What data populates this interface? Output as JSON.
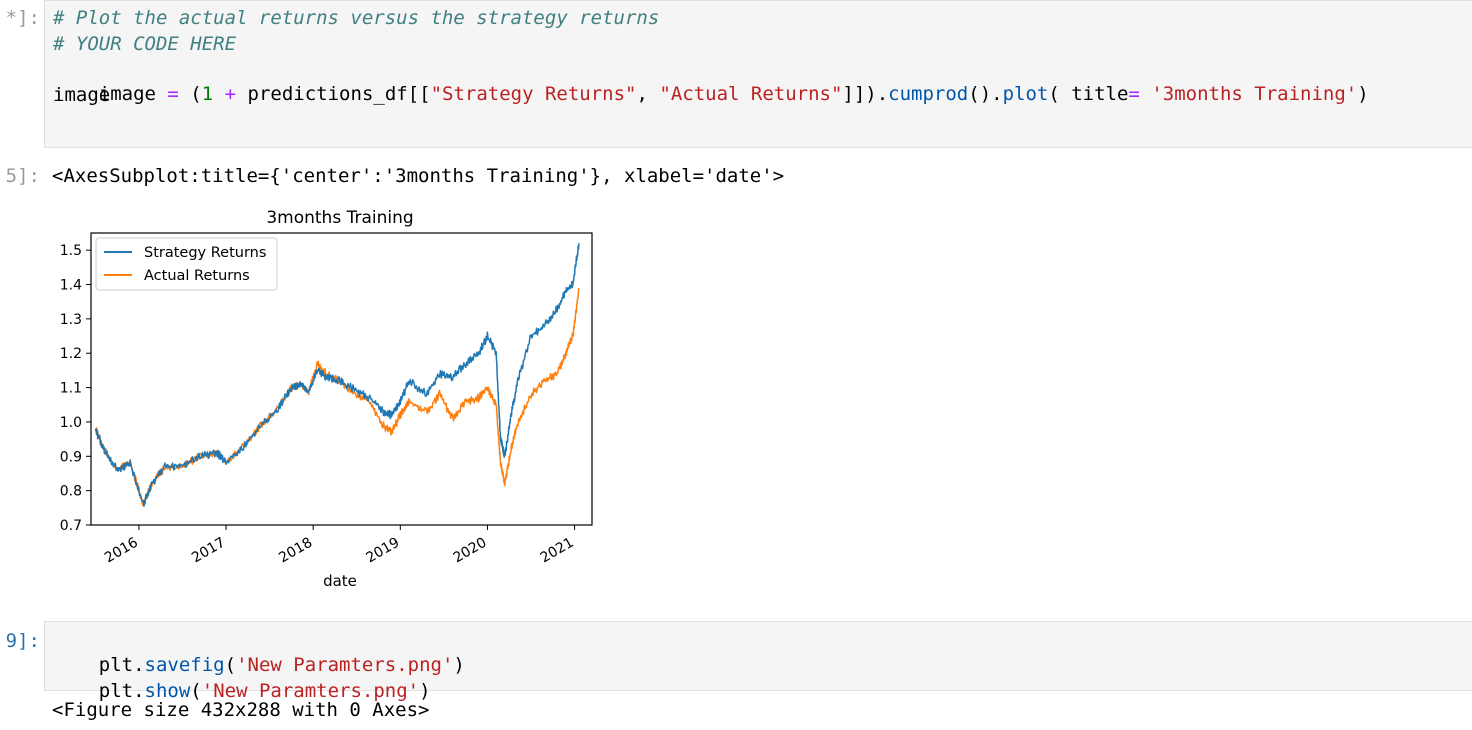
{
  "cell1": {
    "prompt": "*]:",
    "line1": "# Plot the actual returns versus the strategy returns",
    "line2": "# YOUR CODE HERE",
    "line3": {
      "t1": "image ",
      "t2": "=",
      "t3": " (",
      "t4": "1",
      "t5": " ",
      "t6": "+",
      "t7": " predictions_df[[",
      "t8": "\"Strategy Returns\"",
      "t9": ", ",
      "t10": "\"Actual Returns\"",
      "t11": "]]).",
      "t12": "cumprod",
      "t13": "().",
      "t14": "plot",
      "t15": "( title",
      "t16": "=",
      "t17": " ",
      "t18": "'3months Training'",
      "t19": ")"
    },
    "line4": "image"
  },
  "output1": {
    "prompt": "5]:",
    "repr": "<AxesSubplot:title={'center':'3months Training'}, xlabel='date'>"
  },
  "cell2": {
    "prompt": "9]:",
    "line1": {
      "a": "plt.",
      "b": "savefig",
      "c": "(",
      "d": "'New Paramters.png'",
      "e": ")"
    },
    "line2": {
      "a": "plt.",
      "b": "show",
      "c": "(",
      "d": "'New Paramters.png'",
      "e": ")"
    }
  },
  "output2": {
    "text": "<Figure size 432x288 with 0 Axes>"
  },
  "chart_data": {
    "type": "line",
    "title": "3months Training",
    "xlabel": "date",
    "ylabel": "",
    "ylim": [
      0.7,
      1.55
    ],
    "xlim": [
      2015.45,
      2021.2
    ],
    "yticks": [
      "0.7",
      "0.8",
      "0.9",
      "1.0",
      "1.1",
      "1.2",
      "1.3",
      "1.4",
      "1.5"
    ],
    "xticks": [
      "2016",
      "2017",
      "2018",
      "2019",
      "2020",
      "2021"
    ],
    "legend_position": "upper-left",
    "grid": false,
    "series": [
      {
        "name": "Strategy Returns",
        "color": "#1f77b4",
        "x": [
          2015.5,
          2015.6,
          2015.75,
          2015.9,
          2016.05,
          2016.15,
          2016.3,
          2016.5,
          2016.7,
          2016.9,
          2017.0,
          2017.2,
          2017.4,
          2017.6,
          2017.75,
          2017.85,
          2017.95,
          2018.05,
          2018.15,
          2018.3,
          2018.5,
          2018.65,
          2018.8,
          2018.9,
          2019.0,
          2019.1,
          2019.3,
          2019.45,
          2019.6,
          2019.75,
          2019.9,
          2020.0,
          2020.1,
          2020.15,
          2020.2,
          2020.27,
          2020.35,
          2020.5,
          2020.65,
          2020.8,
          2020.9,
          2020.98,
          2021.05
        ],
        "y": [
          0.98,
          0.92,
          0.86,
          0.88,
          0.76,
          0.82,
          0.87,
          0.87,
          0.9,
          0.91,
          0.88,
          0.93,
          0.99,
          1.04,
          1.1,
          1.11,
          1.09,
          1.15,
          1.13,
          1.12,
          1.09,
          1.07,
          1.03,
          1.02,
          1.06,
          1.12,
          1.08,
          1.14,
          1.13,
          1.17,
          1.2,
          1.25,
          1.2,
          0.95,
          0.9,
          1.02,
          1.12,
          1.25,
          1.28,
          1.33,
          1.38,
          1.4,
          1.52
        ]
      },
      {
        "name": "Actual Returns",
        "color": "#ff7f0e",
        "x": [
          2015.5,
          2015.6,
          2015.75,
          2015.9,
          2016.05,
          2016.15,
          2016.3,
          2016.5,
          2016.7,
          2016.9,
          2017.0,
          2017.2,
          2017.4,
          2017.6,
          2017.75,
          2017.85,
          2017.95,
          2018.05,
          2018.15,
          2018.3,
          2018.5,
          2018.65,
          2018.8,
          2018.9,
          2019.0,
          2019.1,
          2019.3,
          2019.45,
          2019.6,
          2019.75,
          2019.9,
          2020.0,
          2020.1,
          2020.15,
          2020.2,
          2020.27,
          2020.35,
          2020.5,
          2020.65,
          2020.8,
          2020.9,
          2020.98,
          2021.05
        ],
        "y": [
          0.98,
          0.92,
          0.86,
          0.88,
          0.76,
          0.82,
          0.87,
          0.87,
          0.9,
          0.91,
          0.88,
          0.93,
          0.99,
          1.04,
          1.1,
          1.11,
          1.09,
          1.17,
          1.14,
          1.12,
          1.08,
          1.06,
          0.99,
          0.97,
          1.02,
          1.06,
          1.03,
          1.08,
          1.01,
          1.06,
          1.07,
          1.1,
          1.05,
          0.88,
          0.82,
          0.92,
          1.0,
          1.08,
          1.12,
          1.14,
          1.2,
          1.25,
          1.39
        ]
      }
    ]
  }
}
